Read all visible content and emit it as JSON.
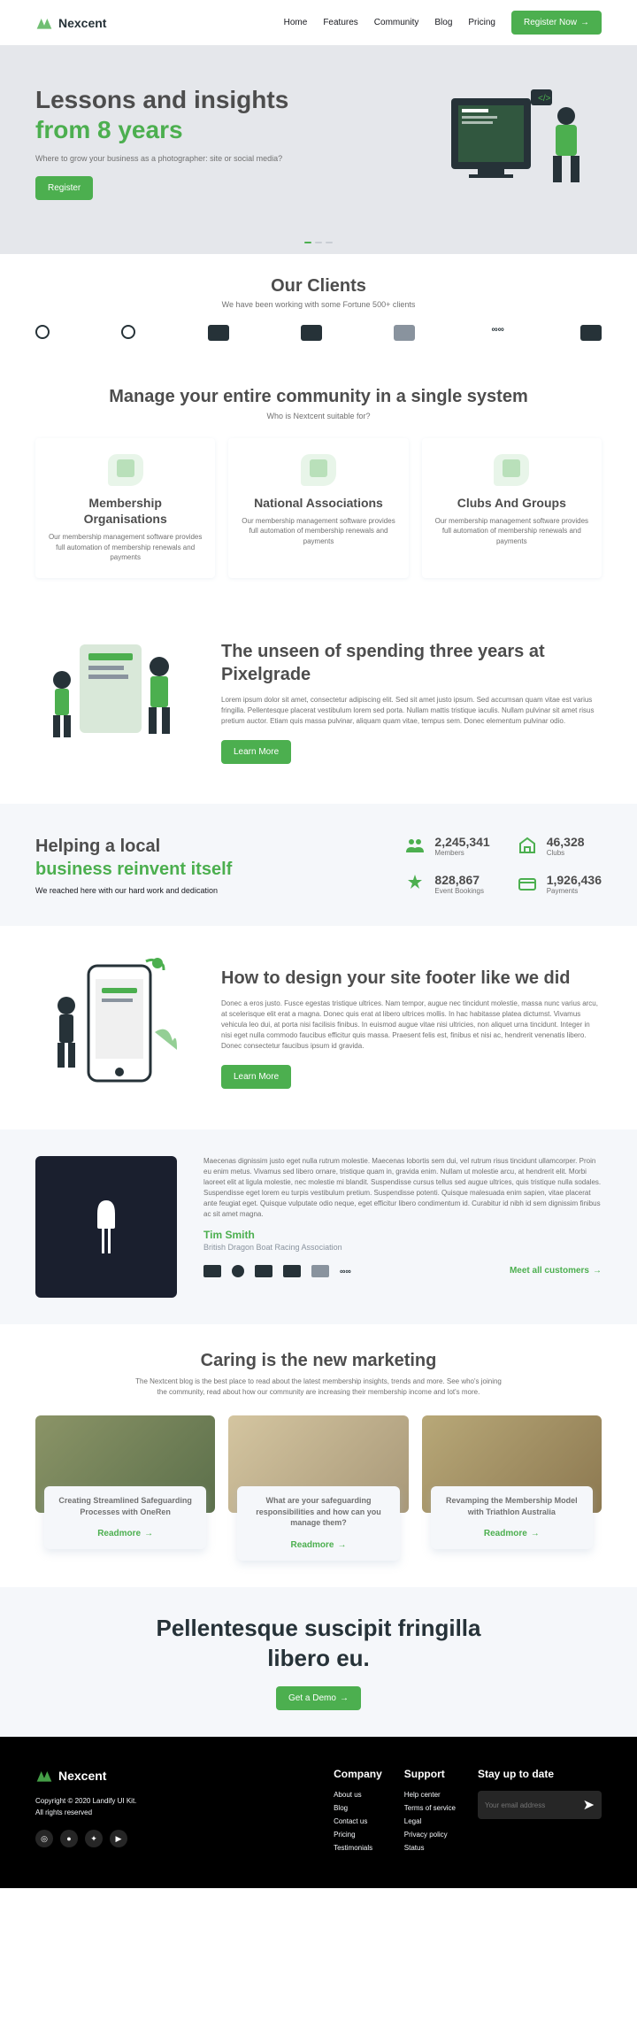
{
  "brand": "Nexcent",
  "nav": {
    "items": [
      "Home",
      "Features",
      "Community",
      "Blog",
      "Pricing"
    ],
    "cta": "Register Now"
  },
  "hero": {
    "title1": "Lessons and insights",
    "title2": "from 8 years",
    "sub": "Where to grow your business as a photographer: site or social media?",
    "btn": "Register"
  },
  "clients": {
    "title": "Our Clients",
    "sub": "We have been working with some Fortune 500+ clients"
  },
  "manage": {
    "title": "Manage your entire community in a single system",
    "sub": "Who is Nextcent suitable for?",
    "cards": [
      {
        "title": "Membership Organisations",
        "desc": "Our membership management software provides full automation of membership renewals and payments"
      },
      {
        "title": "National Associations",
        "desc": "Our membership management software provides full automation of membership renewals and payments"
      },
      {
        "title": "Clubs And Groups",
        "desc": "Our membership management software provides full automation of membership renewals and payments"
      }
    ]
  },
  "pixel": {
    "title": "The unseen of spending three years at Pixelgrade",
    "desc": "Lorem ipsum dolor sit amet, consectetur adipiscing elit. Sed sit amet justo ipsum. Sed accumsan quam vitae est varius fringilla. Pellentesque placerat vestibulum lorem sed porta. Nullam mattis tristique iaculis. Nullam pulvinar sit amet risus pretium auctor. Etiam quis massa pulvinar, aliquam quam vitae, tempus sem. Donec elementum pulvinar odio.",
    "btn": "Learn More"
  },
  "stats": {
    "title1": "Helping a local",
    "title2": "business reinvent itself",
    "sub": "We reached here with our hard work and dedication",
    "items": [
      {
        "num": "2,245,341",
        "lbl": "Members"
      },
      {
        "num": "46,328",
        "lbl": "Clubs"
      },
      {
        "num": "828,867",
        "lbl": "Event Bookings"
      },
      {
        "num": "1,926,436",
        "lbl": "Payments"
      }
    ]
  },
  "footer_design": {
    "title": "How to design your site footer like we did",
    "desc": "Donec a eros justo. Fusce egestas tristique ultrices. Nam tempor, augue nec tincidunt molestie, massa nunc varius arcu, at scelerisque elit erat a magna. Donec quis erat at libero ultrices mollis. In hac habitasse platea dictumst. Vivamus vehicula leo dui, at porta nisi facilisis finibus. In euismod augue vitae nisi ultricies, non aliquet urna tincidunt. Integer in nisi eget nulla commodo faucibus efficitur quis massa. Praesent felis est, finibus et nisi ac, hendrerit venenatis libero. Donec consectetur faucibus ipsum id gravida.",
    "btn": "Learn More"
  },
  "testimonial": {
    "text": "Maecenas dignissim justo eget nulla rutrum molestie. Maecenas lobortis sem dui, vel rutrum risus tincidunt ullamcorper. Proin eu enim metus. Vivamus sed libero ornare, tristique quam in, gravida enim. Nullam ut molestie arcu, at hendrerit elit. Morbi laoreet elit at ligula molestie, nec molestie mi blandit. Suspendisse cursus tellus sed augue ultrices, quis tristique nulla sodales. Suspendisse eget lorem eu turpis vestibulum pretium. Suspendisse potenti. Quisque malesuada enim sapien, vitae placerat ante feugiat eget. Quisque vulputate odio neque, eget efficitur libero condimentum id. Curabitur id nibh id sem dignissim finibus ac sit amet magna.",
    "name": "Tim Smith",
    "role": "British Dragon Boat Racing Association",
    "link": "Meet all customers"
  },
  "blog": {
    "title": "Caring is the new marketing",
    "desc": "The Nextcent blog is the best place to read about the latest membership insights, trends and more. See who's joining the community, read about how our community are increasing their membership income and lot's more.",
    "cards": [
      {
        "title": "Creating Streamlined Safeguarding Processes with OneRen"
      },
      {
        "title": "What are your safeguarding responsibilities and how can you manage them?"
      },
      {
        "title": "Revamping the Membership Model with Triathlon Australia"
      }
    ],
    "link": "Readmore"
  },
  "cta": {
    "title": "Pellentesque suscipit fringilla libero eu.",
    "btn": "Get a Demo"
  },
  "footer": {
    "copy1": "Copyright © 2020 Landify UI Kit.",
    "copy2": "All rights reserved",
    "cols": {
      "company": {
        "title": "Company",
        "links": [
          "About us",
          "Blog",
          "Contact us",
          "Pricing",
          "Testimonials"
        ]
      },
      "support": {
        "title": "Support",
        "links": [
          "Help center",
          "Terms of service",
          "Legal",
          "Privacy policy",
          "Status"
        ]
      },
      "stay": {
        "title": "Stay up to date",
        "placeholder": "Your email address"
      }
    }
  }
}
